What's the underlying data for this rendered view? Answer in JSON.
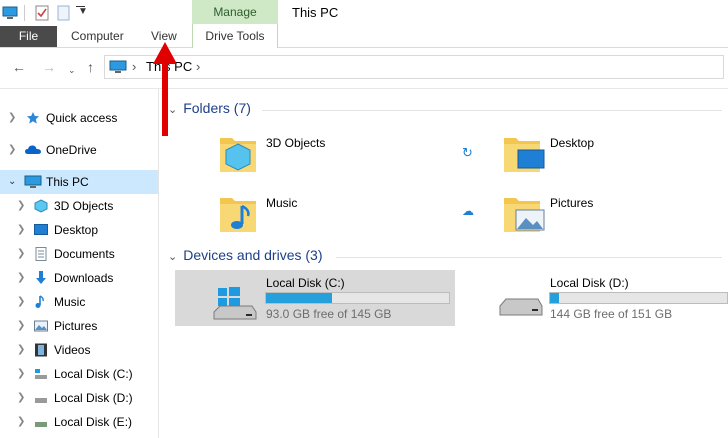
{
  "title_bar": {
    "manage_tab": "Manage",
    "window_title": "This PC"
  },
  "ribbon": {
    "file": "File",
    "computer": "Computer",
    "view": "View",
    "drive_tools": "Drive Tools"
  },
  "address": {
    "path_root": "This PC",
    "separator": "›"
  },
  "nav_pane": {
    "items": [
      {
        "label": "Quick access"
      },
      {
        "label": "OneDrive"
      },
      {
        "label": "This PC"
      },
      {
        "label": "3D Objects"
      },
      {
        "label": "Desktop"
      },
      {
        "label": "Documents"
      },
      {
        "label": "Downloads"
      },
      {
        "label": "Music"
      },
      {
        "label": "Pictures"
      },
      {
        "label": "Videos"
      },
      {
        "label": "Local Disk (C:)"
      },
      {
        "label": "Local Disk (D:)"
      },
      {
        "label": "Local Disk (E:)"
      }
    ]
  },
  "folders": {
    "header": "Folders (7)",
    "items": [
      {
        "name": "3D Objects"
      },
      {
        "name": "Desktop"
      },
      {
        "name": "Music"
      },
      {
        "name": "Pictures"
      }
    ]
  },
  "drives": {
    "header": "Devices and drives (3)",
    "items": [
      {
        "name": "Local Disk (C:)",
        "free_text": "93.0 GB free of 145 GB",
        "used_fraction": 0.36
      },
      {
        "name": "Local Disk (D:)",
        "free_text": "144 GB free of 151 GB",
        "used_fraction": 0.05
      }
    ]
  },
  "colors": {
    "accent": "#26a0da",
    "selection": "#cce8ff",
    "manage_tab": "#cfe8c6",
    "annotation_arrow": "#e00000"
  }
}
